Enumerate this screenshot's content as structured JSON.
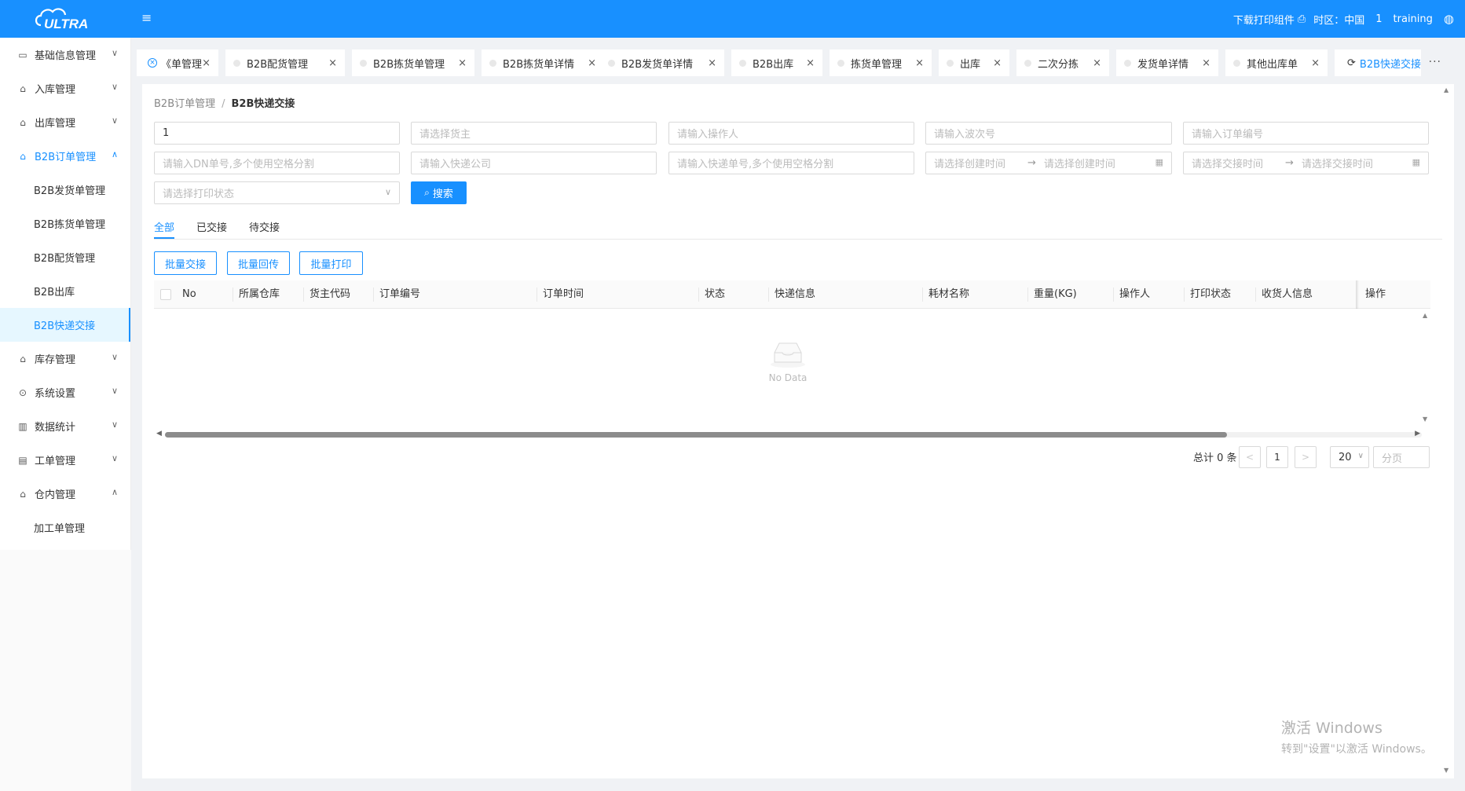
{
  "header": {
    "logo_text": "ULTRA",
    "print_component": "下载打印组件",
    "timezone": "时区：中国",
    "number": "1",
    "user": "training",
    "icons": [
      "menu-icon",
      "printer-icon",
      "globe-icon"
    ]
  },
  "sidebar": {
    "items": [
      {
        "label": "基础信息管理",
        "icon": "info-icon",
        "expanded": false
      },
      {
        "label": "入库管理",
        "icon": "inbound-icon",
        "expanded": false
      },
      {
        "label": "出库管理",
        "icon": "outbound-icon",
        "expanded": false
      },
      {
        "label": "B2B订单管理",
        "icon": "order-icon",
        "expanded": true
      },
      {
        "label": "库存管理",
        "icon": "inventory-icon",
        "expanded": false
      },
      {
        "label": "系统设置",
        "icon": "settings-icon",
        "expanded": false
      },
      {
        "label": "数据统计",
        "icon": "chart-icon",
        "expanded": false
      },
      {
        "label": "工单管理",
        "icon": "workorder-icon",
        "expanded": false
      },
      {
        "label": "仓内管理",
        "icon": "warehouse-icon",
        "expanded": true
      }
    ],
    "b2b_subitems": [
      "B2B发货单管理",
      "B2B拣货单管理",
      "B2B配货管理",
      "B2B出库",
      "B2B快递交接"
    ],
    "warehouse_subitems": [
      "加工单管理"
    ],
    "active_sub": "B2B快递交接"
  },
  "tabs": [
    {
      "label": "《单管理"
    },
    {
      "label": "B2B配货管理"
    },
    {
      "label": "B2B拣货单管理"
    },
    {
      "label": "B2B拣货单详情"
    },
    {
      "label": "B2B发货单详情"
    },
    {
      "label": "B2B出库"
    },
    {
      "label": "拣货单管理"
    },
    {
      "label": "出库"
    },
    {
      "label": "二次分拣"
    },
    {
      "label": "发货单详情"
    },
    {
      "label": "其他出库单"
    },
    {
      "label": "B2B快递交接"
    }
  ],
  "tabs_more": "···",
  "breadcrumb": {
    "parent": "B2B订单管理",
    "separator": "/",
    "current": "B2B快递交接"
  },
  "filters": {
    "row1": {
      "first_value": "1",
      "owner_placeholder": "请选择货主",
      "operator_placeholder": "请输入操作人",
      "wave_placeholder": "请输入波次号",
      "order_placeholder": "请输入订单编号"
    },
    "row2": {
      "dn_placeholder": "请输入DN单号,多个使用空格分割",
      "express_company_placeholder": "请输入快递公司",
      "express_no_placeholder": "请输入快递单号,多个使用空格分割",
      "create_start": "请选择创建时间",
      "create_end": "请选择创建时间",
      "handover_start": "请选择交接时间",
      "handover_end": "请选择交接时间",
      "arrow": "→"
    },
    "print_status_placeholder": "请选择打印状态",
    "search_label": "搜索"
  },
  "status_tabs": [
    "全部",
    "已交接",
    "待交接"
  ],
  "active_status_tab": "全部",
  "actions": {
    "batch_handover": "批量交接",
    "batch_return": "批量回传",
    "batch_print": "批量打印"
  },
  "table": {
    "columns": [
      "No",
      "所属仓库",
      "货主代码",
      "订单编号",
      "订单时间",
      "状态",
      "快递信息",
      "耗材名称",
      "重量(KG)",
      "操作人",
      "打印状态",
      "收货人信息",
      "操作"
    ],
    "rows": [],
    "empty_text": "No Data"
  },
  "pagination": {
    "total": "总计 0 条",
    "current_page": "1",
    "page_size": "20",
    "jump_placeholder": "分页"
  },
  "watermark": {
    "line1": "激活 Windows",
    "line2": "转到\"设置\"以激活 Windows。"
  },
  "colors": {
    "primary": "#1890ff",
    "active_bg": "#e6f7ff"
  }
}
